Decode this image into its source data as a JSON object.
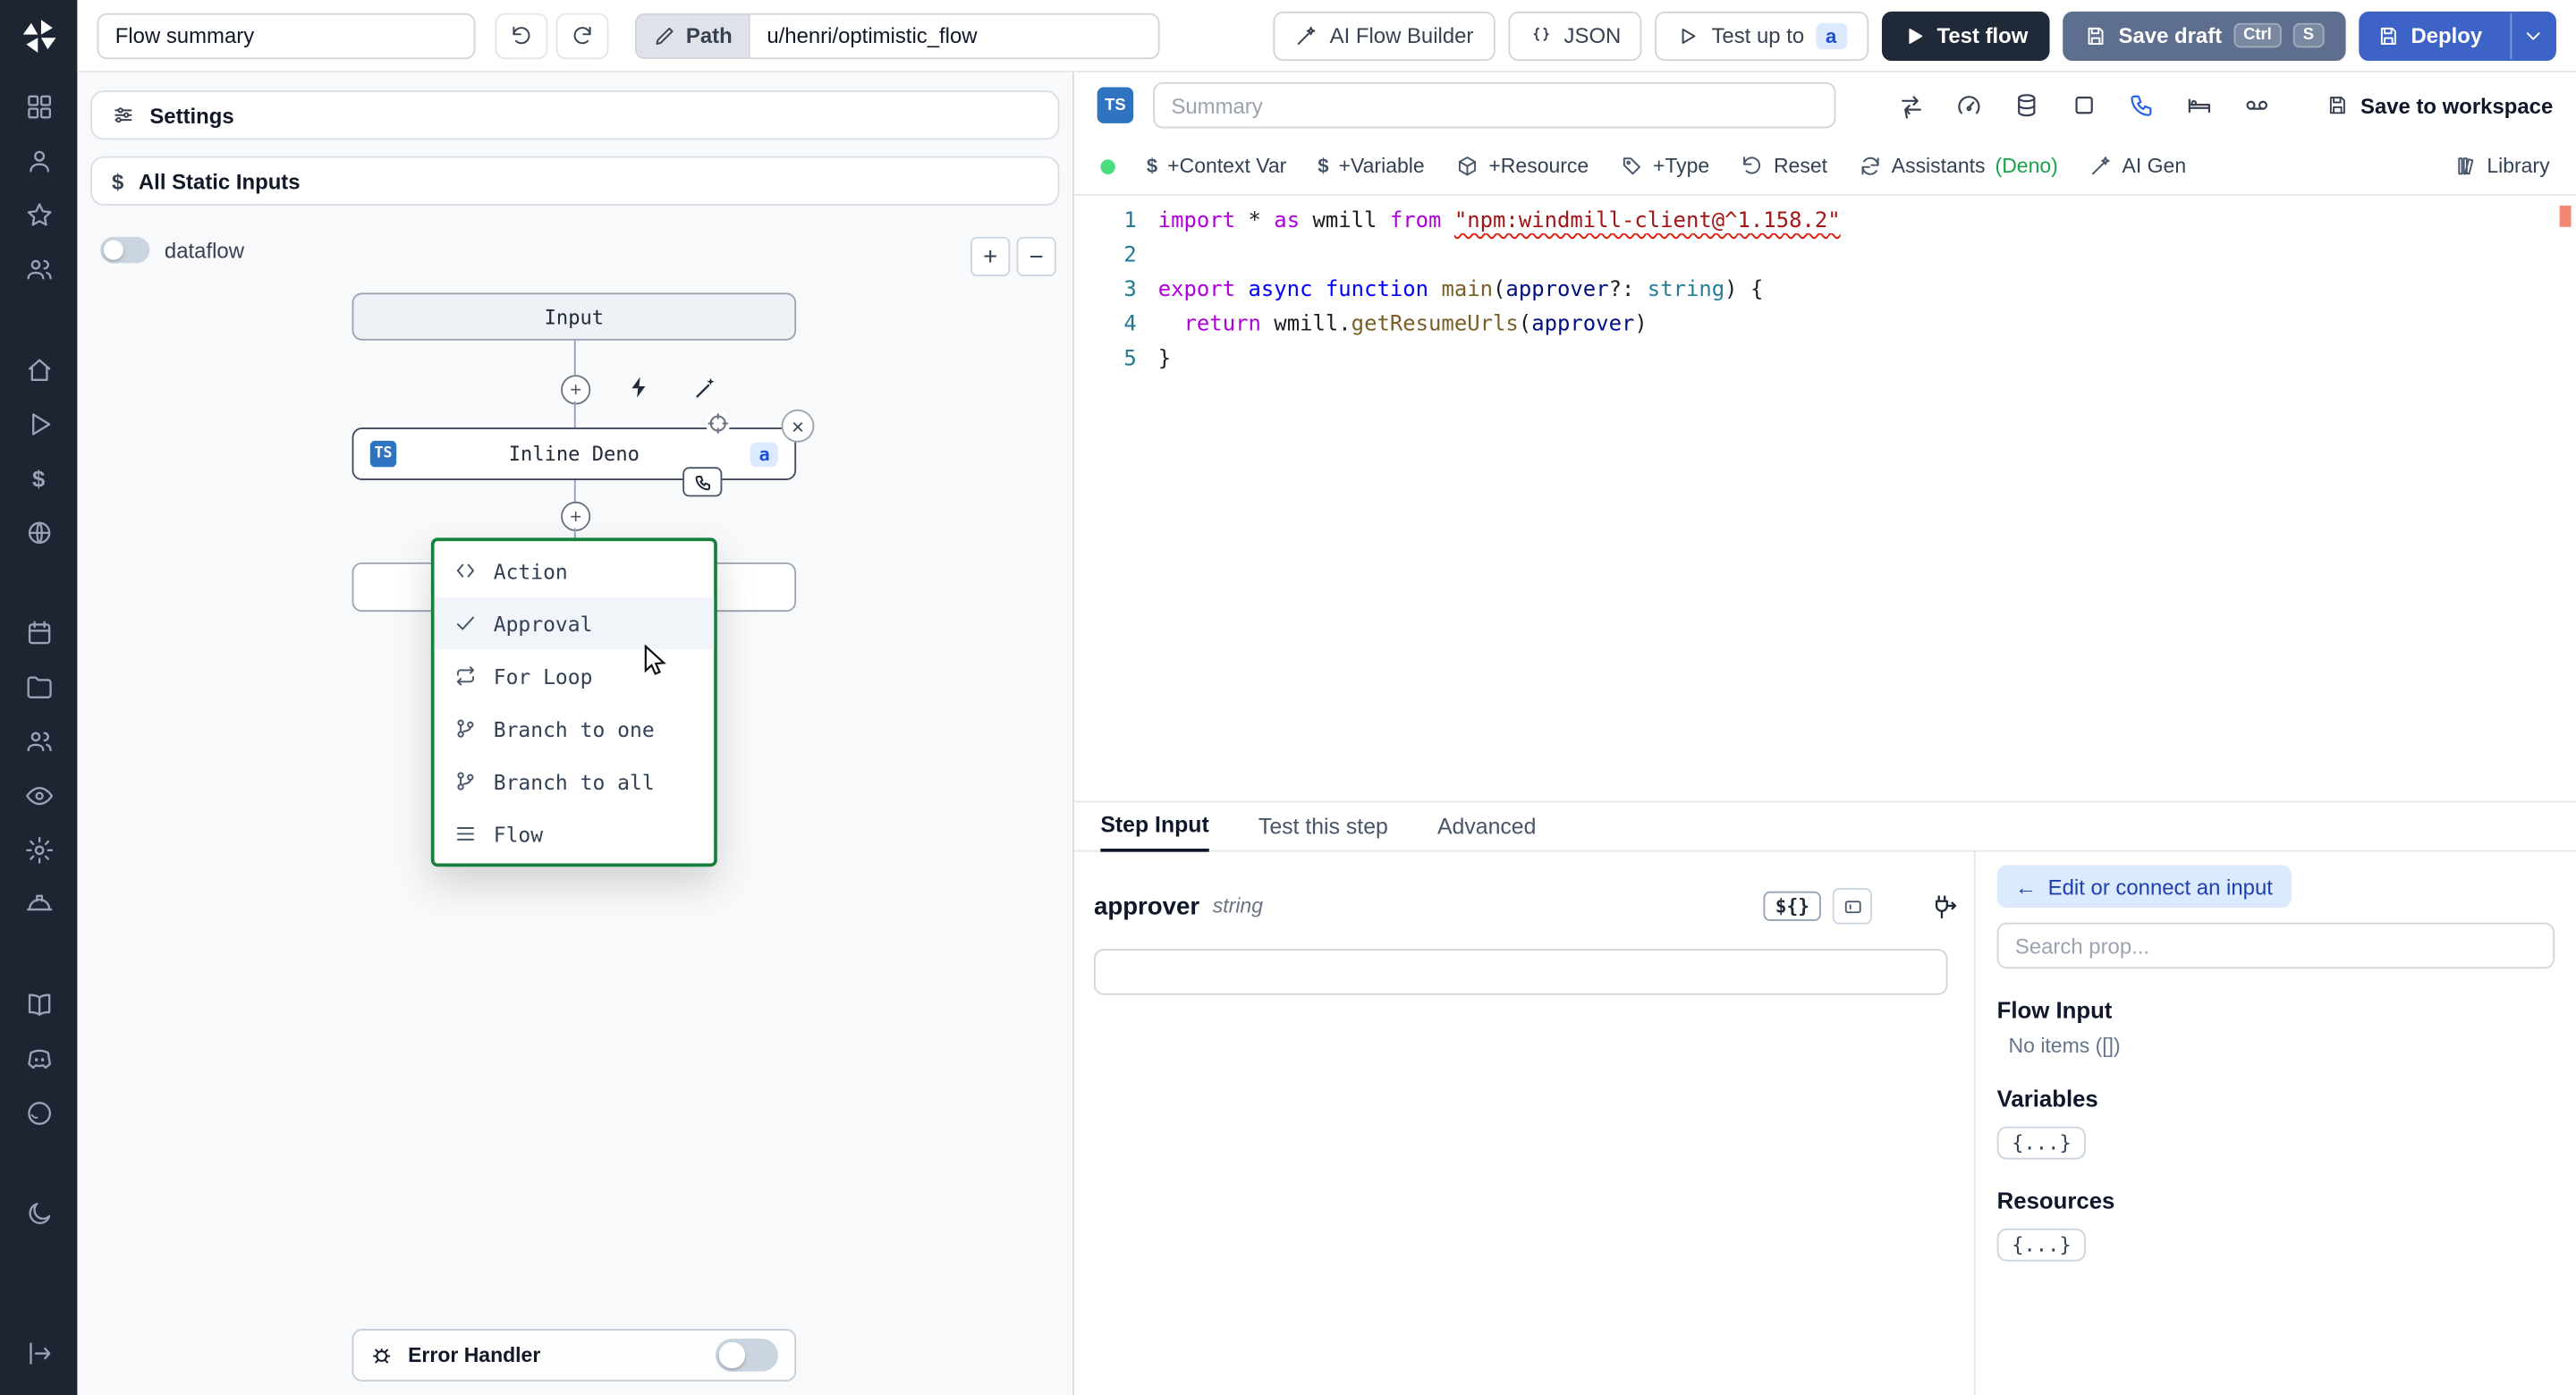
{
  "icons": {
    "plus": "+",
    "minus": "−",
    "close": "×",
    "chevron_down": "⌄",
    "arrow_left": "←",
    "dollar": "$",
    "braces_badge": "{...}",
    "dollar_braces": "${}"
  },
  "topbar": {
    "flow_summary": "Flow summary",
    "path_label": "Path",
    "path_value": "u/henri/optimistic_flow",
    "ai_flow_builder": "AI Flow Builder",
    "json_label": "JSON",
    "test_up_to": "Test up to",
    "test_up_to_badge": "a",
    "test_flow": "Test flow",
    "save_draft": "Save draft",
    "kbd_ctrl": "Ctrl",
    "kbd_s": "S",
    "deploy": "Deploy"
  },
  "left_panel": {
    "settings_label": "Settings",
    "static_inputs_label": "All Static Inputs",
    "dataflow_label": "dataflow",
    "input_node": "Input",
    "inline_node": "Inline Deno",
    "ts": "TS",
    "node_badge": "a",
    "error_handler": "Error Handler",
    "menu": {
      "items": [
        {
          "label": "Action"
        },
        {
          "label": "Approval"
        },
        {
          "label": "For Loop"
        },
        {
          "label": "Branch to one"
        },
        {
          "label": "Branch to all"
        },
        {
          "label": "Flow"
        }
      ]
    }
  },
  "editor": {
    "ts": "TS",
    "summary_placeholder": "Summary",
    "save_workspace": "Save to workspace",
    "toolbar": {
      "context_var": "+Context Var",
      "variable": "+Variable",
      "resource": "+Resource",
      "type": "+Type",
      "reset": "Reset",
      "assistants": "Assistants",
      "assistants_lang": "(Deno)",
      "ai_gen": "AI Gen",
      "library": "Library"
    },
    "code": {
      "lines": [
        [
          {
            "t": "import",
            "c": "ctl"
          },
          {
            "t": " * "
          },
          {
            "t": "as",
            "c": "ctl"
          },
          {
            "t": " wmill "
          },
          {
            "t": "from",
            "c": "ctl"
          },
          {
            "t": " "
          },
          {
            "t": "\"npm:windmill-client@^1.158.2\"",
            "c": "str sq"
          }
        ],
        [],
        [
          {
            "t": "export",
            "c": "ctl"
          },
          {
            "t": " "
          },
          {
            "t": "async",
            "c": "kw"
          },
          {
            "t": " "
          },
          {
            "t": "function",
            "c": "kw"
          },
          {
            "t": " "
          },
          {
            "t": "main",
            "c": "fn"
          },
          {
            "t": "("
          },
          {
            "t": "approver",
            "c": "var"
          },
          {
            "t": "?: "
          },
          {
            "t": "string",
            "c": "type"
          },
          {
            "t": ") {"
          }
        ],
        [
          {
            "t": "  "
          },
          {
            "t": "return",
            "c": "ctl"
          },
          {
            "t": " wmill."
          },
          {
            "t": "getResumeUrls",
            "c": "fn"
          },
          {
            "t": "("
          },
          {
            "t": "approver",
            "c": "var"
          },
          {
            "t": ")"
          }
        ],
        [
          {
            "t": "}"
          }
        ]
      ]
    }
  },
  "tabs": {
    "step_input": "Step Input",
    "test_step": "Test this step",
    "advanced": "Advanced"
  },
  "step_input": {
    "name": "approver",
    "type": "string",
    "value": ""
  },
  "inspector": {
    "edit_connect": "Edit or connect an input",
    "search_placeholder": "Search prop...",
    "flow_input": "Flow Input",
    "no_items": "No items ([])",
    "variables": "Variables",
    "resources": "Resources"
  }
}
